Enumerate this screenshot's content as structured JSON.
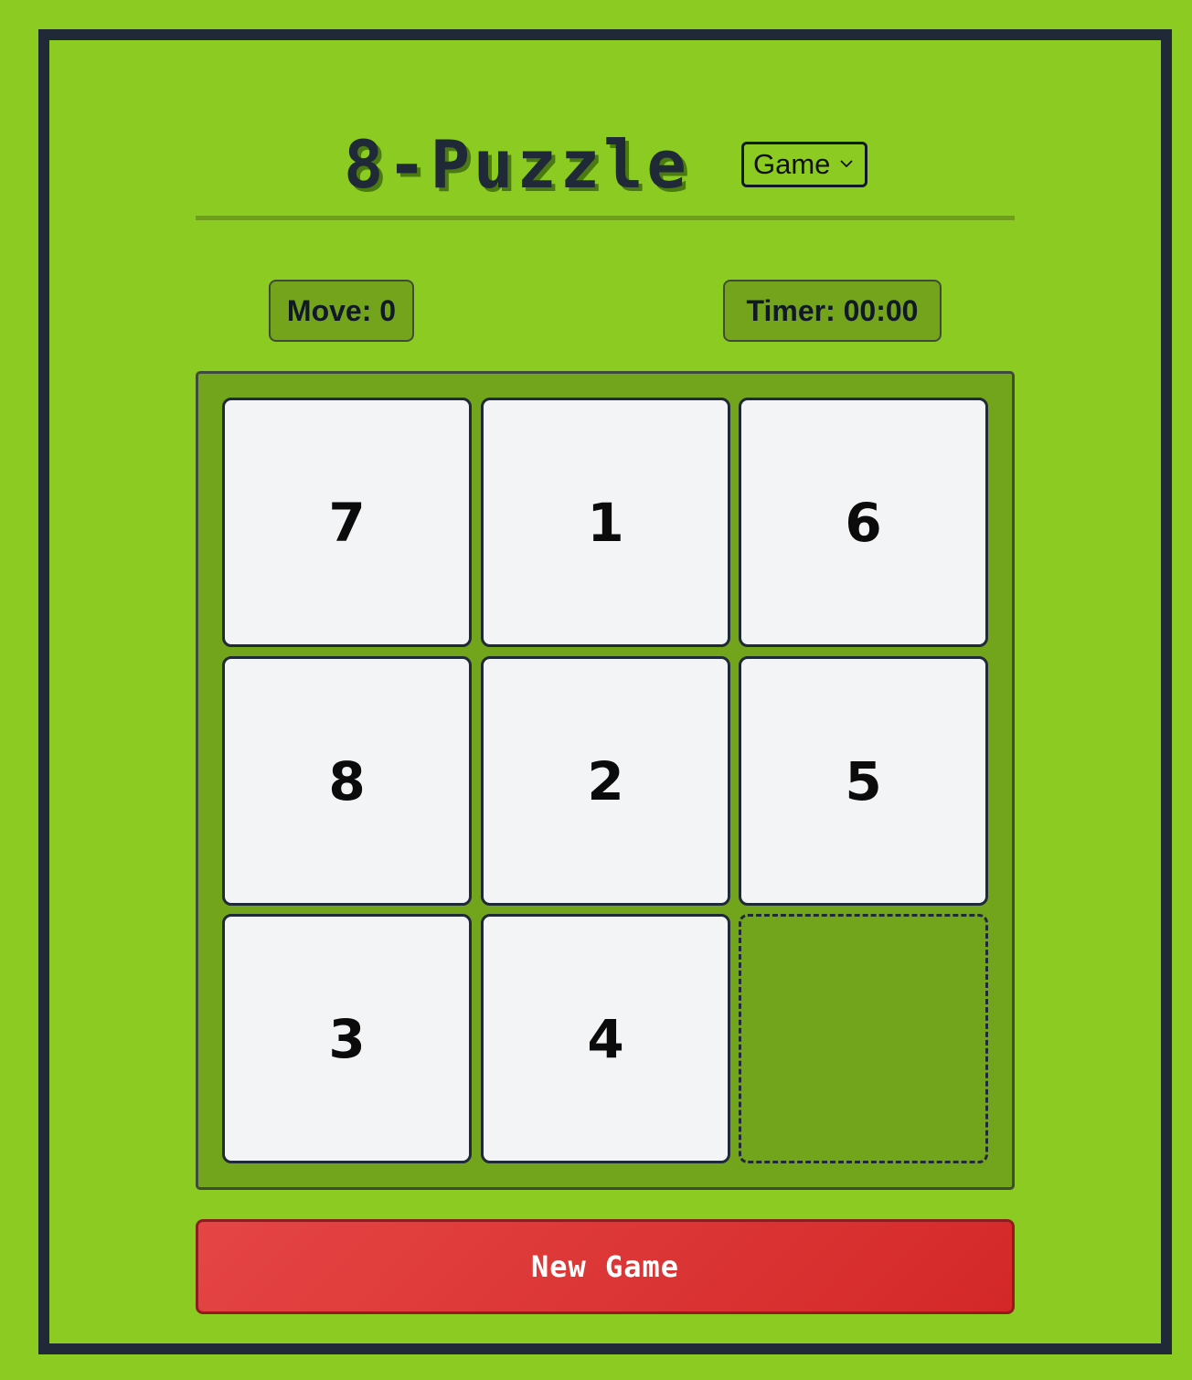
{
  "header": {
    "title": "8-Puzzle",
    "mode_select": {
      "selected": "Game"
    }
  },
  "stats": {
    "move_label": "Move: 0",
    "timer_label": "Timer: 00:00"
  },
  "board": {
    "tiles": [
      "7",
      "1",
      "6",
      "8",
      "2",
      "5",
      "3",
      "4",
      ""
    ]
  },
  "actions": {
    "new_game_label": "New Game"
  },
  "colors": {
    "background": "#8ccc22",
    "frame": "#1f2937",
    "board": "#73a51c",
    "tile": "#f3f4f6",
    "new_game_button": "#dc3535"
  },
  "icons": {
    "select_arrow": "chevron-down-icon"
  }
}
